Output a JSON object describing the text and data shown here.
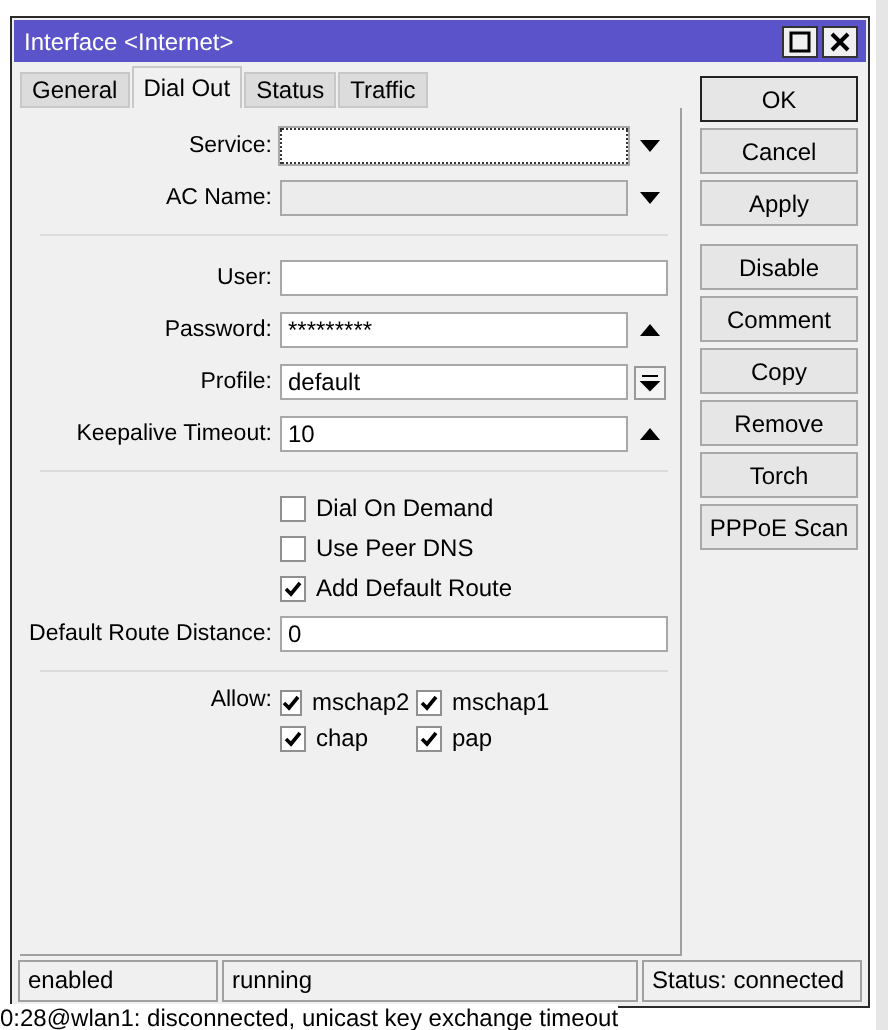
{
  "window": {
    "title": "Interface <Internet>"
  },
  "tabs": [
    {
      "label": "General",
      "selected": false
    },
    {
      "label": "Dial Out",
      "selected": true
    },
    {
      "label": "Status",
      "selected": false
    },
    {
      "label": "Traffic",
      "selected": false
    }
  ],
  "connection_fields": [
    {
      "label": "Service:",
      "kind": "dropdown",
      "focused": true,
      "disabled": false
    },
    {
      "label": "AC Name:",
      "kind": "dropdown",
      "focused": false,
      "disabled": true
    }
  ],
  "login_fields": [
    {
      "label": "User:",
      "kind": "plain",
      "focused": false,
      "disabled": false
    },
    {
      "label": "Password:",
      "kind": "collapse",
      "value": "*********",
      "focused": false,
      "disabled": false
    },
    {
      "label": "Profile:",
      "kind": "select",
      "value": "default",
      "focused": false,
      "disabled": false
    },
    {
      "label": "Keepalive Timeout:",
      "kind": "collapse",
      "value": "10",
      "focused": false,
      "disabled": false
    }
  ],
  "options": [
    {
      "label": "Dial On Demand",
      "checked": false
    },
    {
      "label": "Use Peer DNS",
      "checked": false
    },
    {
      "label": "Add Default Route",
      "checked": true
    }
  ],
  "route_distance": {
    "label": "Default Route Distance:",
    "value": "0"
  },
  "allow": {
    "label": "Allow:",
    "options": [
      {
        "label": "mschap2",
        "checked": true
      },
      {
        "label": "mschap1",
        "checked": true
      },
      {
        "label": "chap",
        "checked": true
      },
      {
        "label": "pap",
        "checked": true
      }
    ]
  },
  "dialog_buttons": [
    {
      "label": "OK",
      "default": true
    },
    {
      "label": "Cancel",
      "default": false
    },
    {
      "label": "Apply",
      "default": false
    }
  ],
  "action_buttons": [
    {
      "label": "Disable"
    },
    {
      "label": "Comment"
    },
    {
      "label": "Copy"
    },
    {
      "label": "Remove"
    },
    {
      "label": "Torch"
    },
    {
      "label": "PPPoE Scan"
    }
  ],
  "status_bar": [
    "enabled",
    "running",
    "Status: connected"
  ],
  "log_line": "0:28@wlan1: disconnected, unicast key exchange timeout"
}
